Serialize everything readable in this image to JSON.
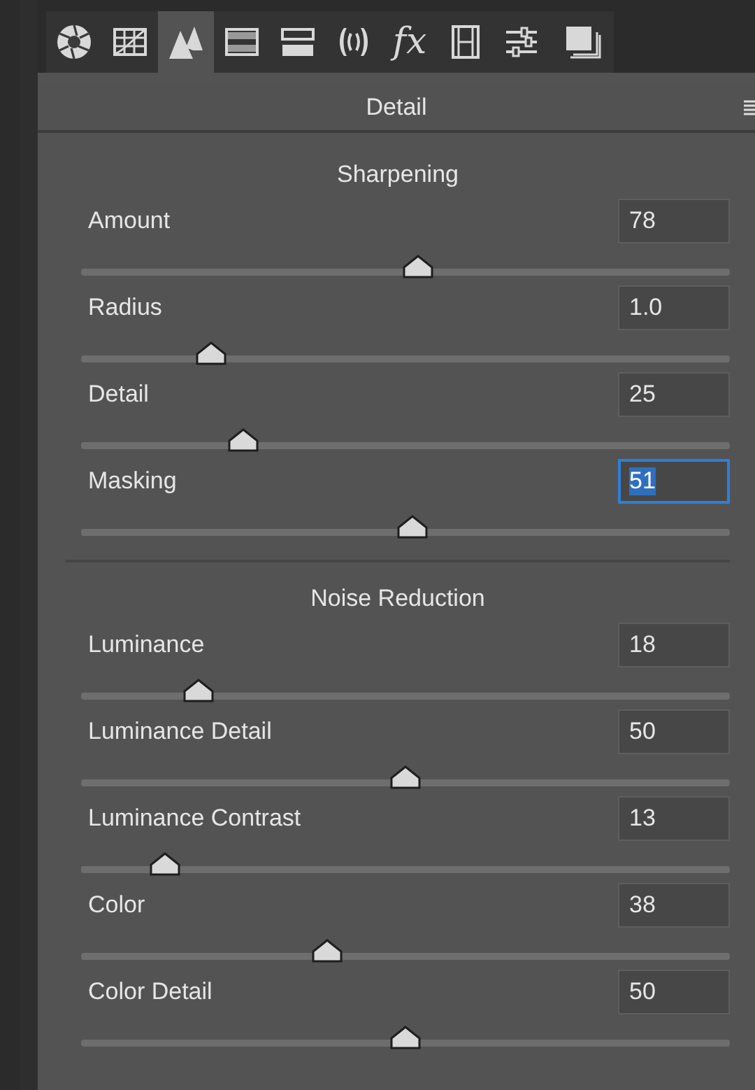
{
  "tabs": [
    {
      "kind": "aperture",
      "selected": false
    },
    {
      "kind": "curve",
      "selected": false
    },
    {
      "kind": "peaks",
      "selected": true
    },
    {
      "kind": "gradient",
      "selected": false
    },
    {
      "kind": "split",
      "selected": false
    },
    {
      "kind": "lens",
      "selected": false
    },
    {
      "kind": "fx",
      "label": "fx",
      "selected": false
    },
    {
      "kind": "film",
      "selected": false
    },
    {
      "kind": "sliders",
      "selected": false
    },
    {
      "kind": "stack",
      "selected": false
    }
  ],
  "panel": {
    "title": "Detail"
  },
  "sections": [
    {
      "title": "Sharpening",
      "controls": [
        {
          "label": "Amount",
          "value": "78",
          "level": 0.52,
          "focused": false
        },
        {
          "label": "Radius",
          "value": "1.0",
          "level": 0.2,
          "focused": false
        },
        {
          "label": "Detail",
          "value": "25",
          "level": 0.25,
          "focused": false
        },
        {
          "label": "Masking",
          "value": "51",
          "level": 0.51,
          "focused": true
        }
      ]
    },
    {
      "title": "Noise Reduction",
      "controls": [
        {
          "label": "Luminance",
          "value": "18",
          "level": 0.18,
          "focused": false
        },
        {
          "label": "Luminance Detail",
          "value": "50",
          "level": 0.5,
          "focused": false
        },
        {
          "label": "Luminance Contrast",
          "value": "13",
          "level": 0.13,
          "focused": false
        },
        {
          "label": "Color",
          "value": "38",
          "level": 0.38,
          "focused": false
        },
        {
          "label": "Color Detail",
          "value": "50",
          "level": 0.5,
          "focused": false
        }
      ]
    }
  ]
}
